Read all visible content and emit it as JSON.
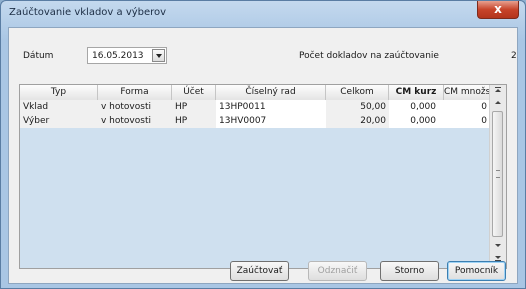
{
  "window": {
    "title": "Zaúčtovanie vkladov a výberov",
    "close_glyph": "x"
  },
  "form": {
    "date_label": "Dátum",
    "date_value": "16.05.2013",
    "count_label": "Počet dokladov na zaúčtovanie",
    "count_value": "2"
  },
  "table": {
    "columns": [
      "Typ",
      "Forma",
      "Účet",
      "Číselný rad",
      "Celkom",
      "CM kurz",
      "CM množstvo"
    ],
    "rows": [
      [
        "Vklad",
        "v hotovosti",
        "HP",
        "13HP0011",
        "50,00",
        "0,000",
        "0"
      ],
      [
        "Výber",
        "v hotovosti",
        "HP",
        "13HV0007",
        "20,00",
        "0,000",
        "0"
      ]
    ]
  },
  "buttons": {
    "post": "Zaúčtovať",
    "unmark": "Odznačiť",
    "cancel": "Storno",
    "help": "Pomocník"
  },
  "icons": {
    "scroll_top": "scroll-top-icon",
    "scroll_up": "scroll-up-icon",
    "scroll_down": "scroll-down-icon",
    "scroll_bottom": "scroll-bottom-icon"
  },
  "colors": {
    "grid_background": "#cfe0ef",
    "close_button": "#c7442a",
    "frame": "#a9c6e4"
  }
}
